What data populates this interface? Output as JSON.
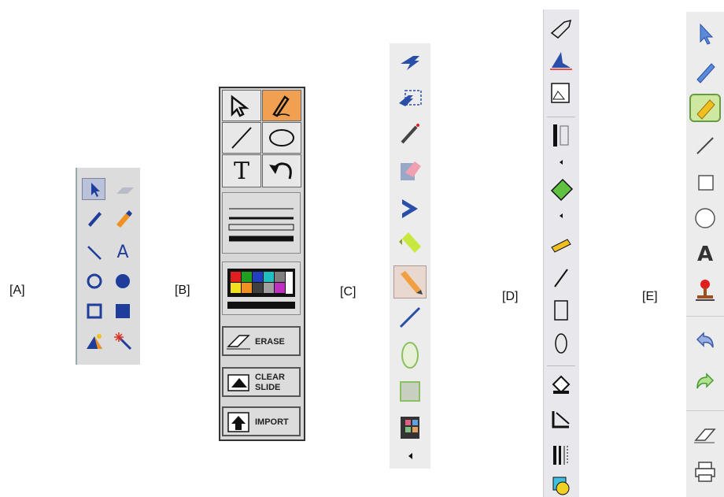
{
  "labels": {
    "a": "[A]",
    "b": "[B]",
    "c": "[C]",
    "d": "[D]",
    "e": "[E]"
  },
  "panel_b": {
    "erase_label": "ERASE",
    "clear_label_1": "CLEAR",
    "clear_label_2": "SLIDE",
    "import_label": "IMPORT",
    "text_tool_glyph": "T"
  },
  "panel_e": {
    "text_tool_glyph": "A"
  },
  "panel_a": {
    "text_tool_glyph": "A"
  },
  "colors": {
    "highlight_orange": "#f0a050",
    "selection_green": "#8bc34a",
    "icon_blue": "#1f3d9a",
    "palette": [
      "#e02020",
      "#20a020",
      "#2040c0",
      "#20c0c0",
      "#f0e020",
      "#f09020",
      "#c030c0",
      "#a0a0a0",
      "#ffffff"
    ]
  }
}
